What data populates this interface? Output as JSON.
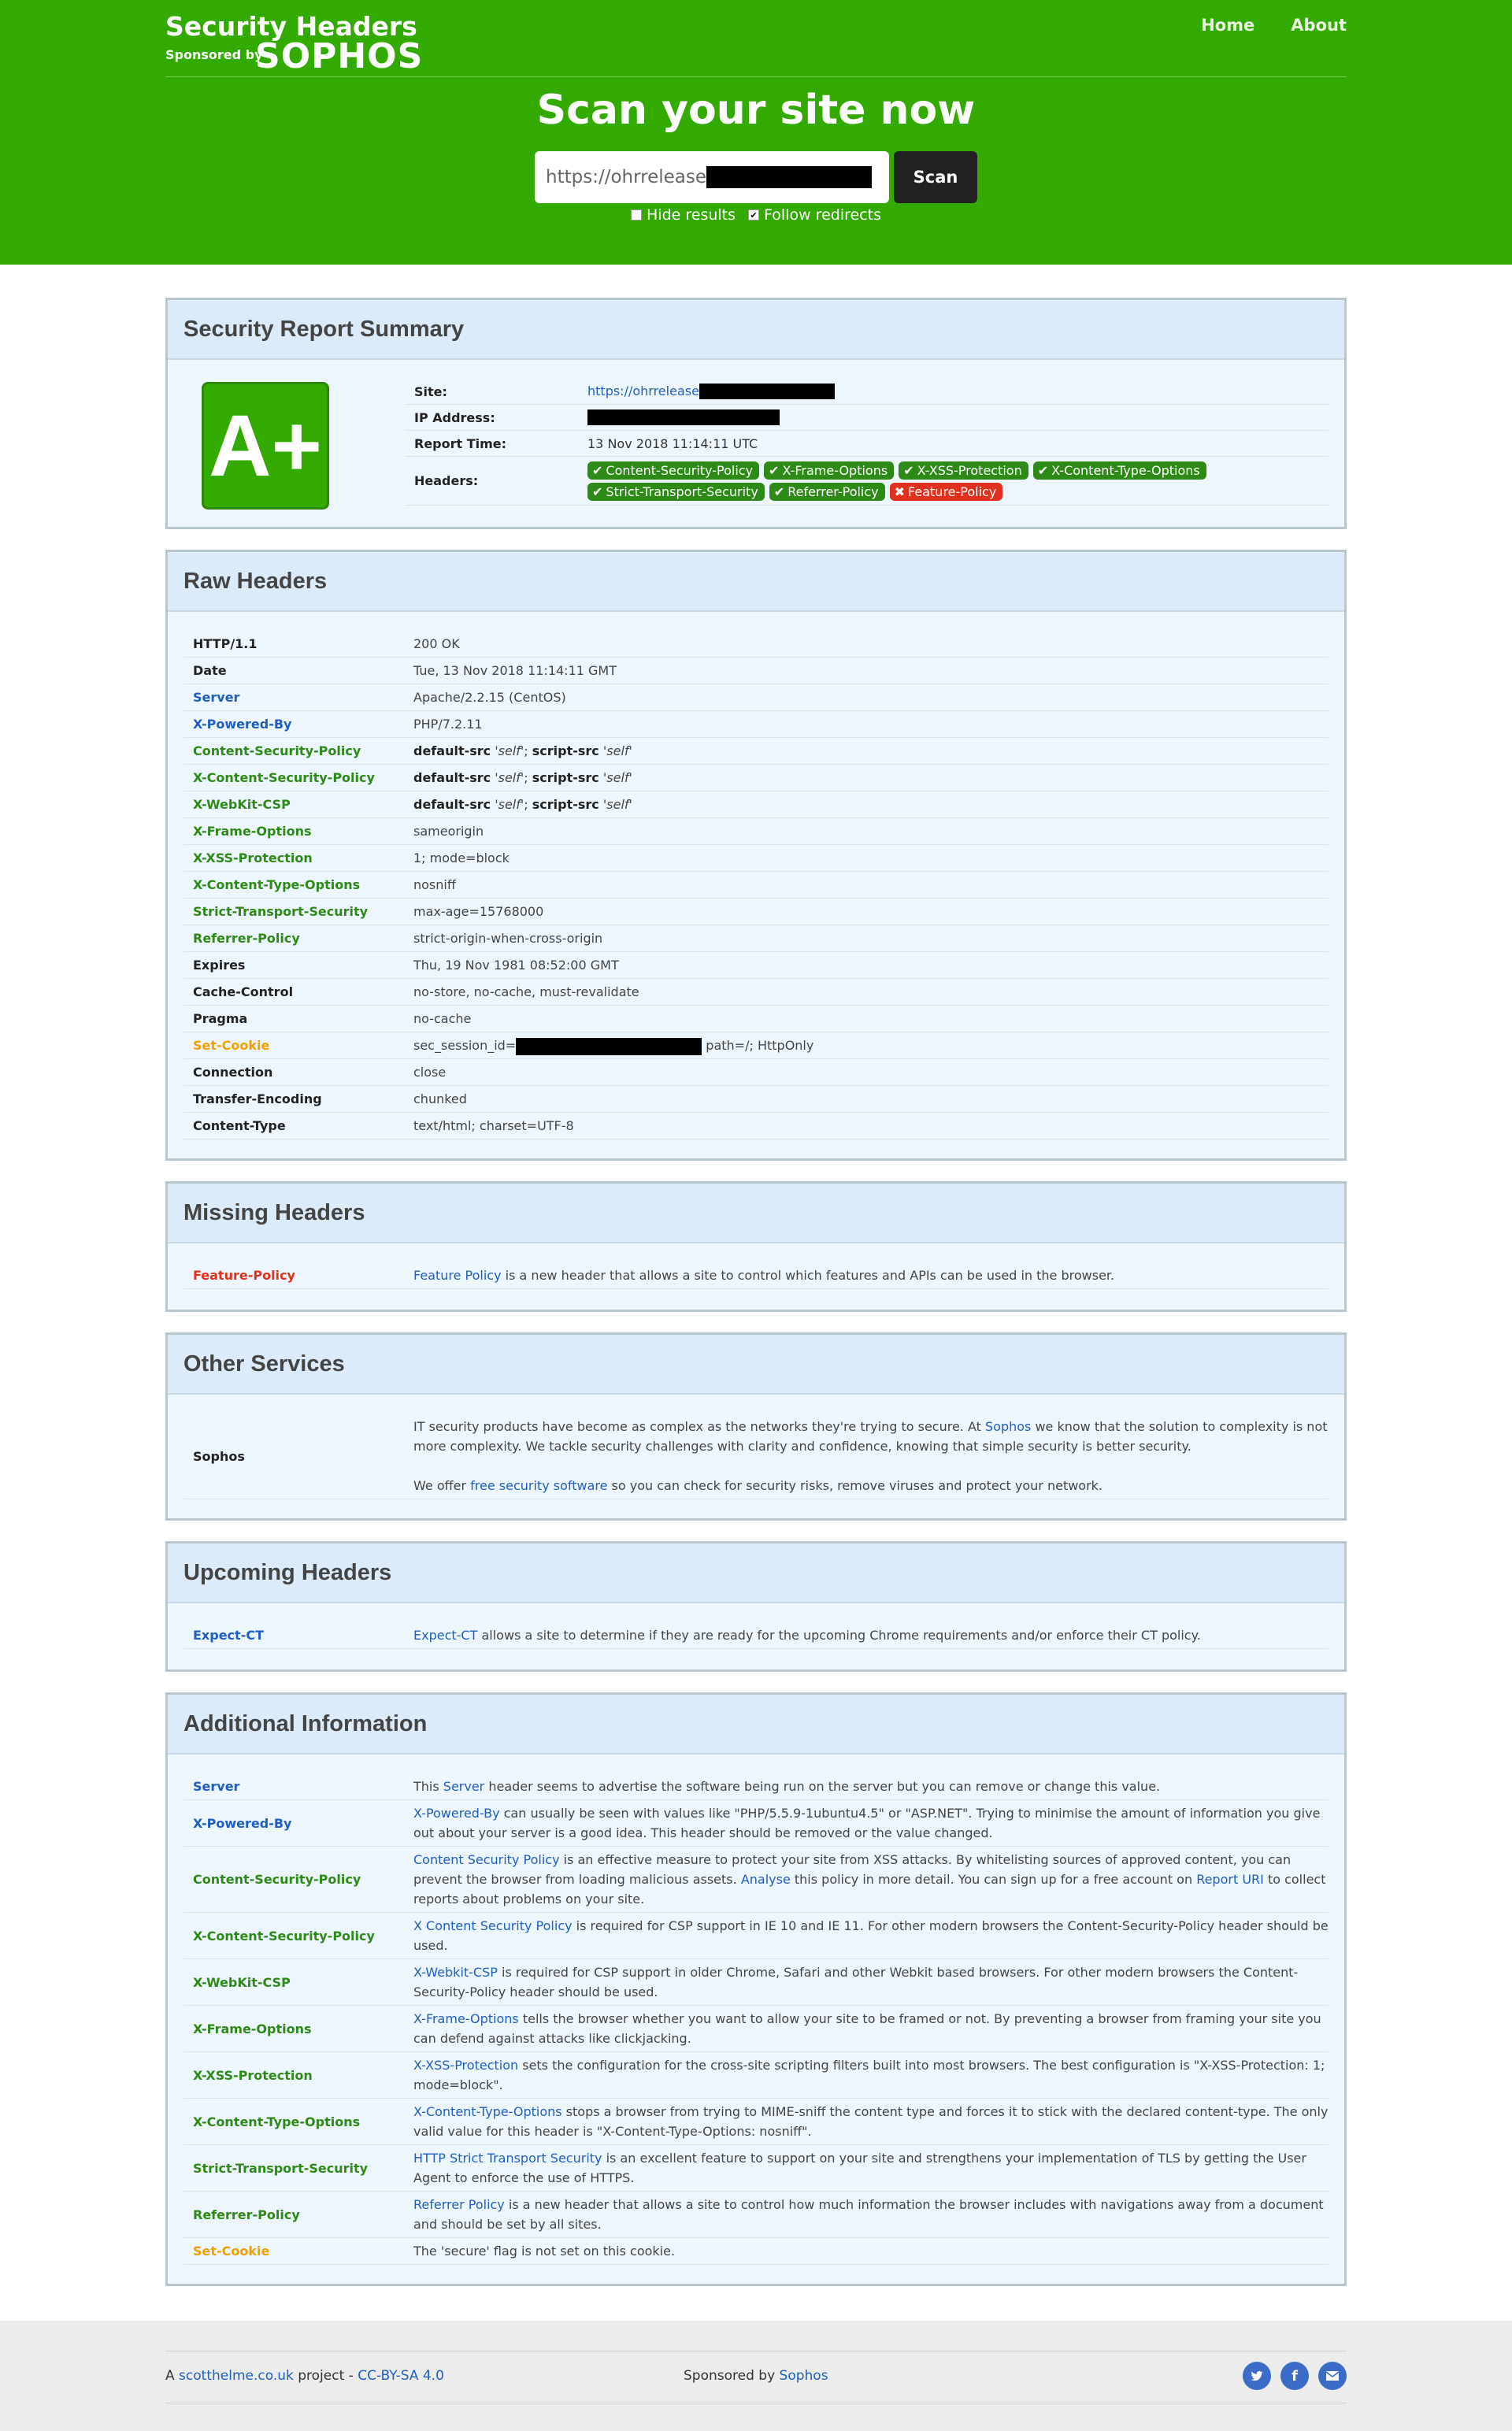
{
  "header": {
    "brand_title": "Security Headers",
    "sponsored_by": "Sponsored by",
    "sponsor_logo": "SOPHOS",
    "nav": {
      "home": "Home",
      "about": "About"
    },
    "headline": "Scan your site now",
    "url_value": "https://ohrrelease",
    "scan_label": "Scan",
    "hide_results_label": "Hide results",
    "follow_redirects_label": "Follow redirects"
  },
  "summary": {
    "title": "Security Report Summary",
    "grade": "A+",
    "rows": {
      "site_key": "Site:",
      "site_val": "https://ohrrelease",
      "ip_key": "IP Address:",
      "time_key": "Report Time:",
      "time_val": "13 Nov 2018 11:14:11 UTC",
      "headers_key": "Headers:"
    },
    "badges": [
      {
        "label": "Content-Security-Policy",
        "ok": true
      },
      {
        "label": "X-Frame-Options",
        "ok": true
      },
      {
        "label": "X-XSS-Protection",
        "ok": true
      },
      {
        "label": "X-Content-Type-Options",
        "ok": true
      },
      {
        "label": "Strict-Transport-Security",
        "ok": true
      },
      {
        "label": "Referrer-Policy",
        "ok": true
      },
      {
        "label": "Feature-Policy",
        "ok": false
      }
    ]
  },
  "raw": {
    "title": "Raw Headers",
    "rows": [
      {
        "key": "HTTP/1.1",
        "val": "200 OK",
        "color": "black"
      },
      {
        "key": "Date",
        "val": "Tue, 13 Nov 2018 11:14:11 GMT",
        "color": "black"
      },
      {
        "key": "Server",
        "val": "Apache/2.2.15 (CentOS)",
        "color": "blue"
      },
      {
        "key": "X-Powered-By",
        "val": "PHP/7.2.11",
        "color": "blue"
      },
      {
        "key": "Content-Security-Policy",
        "csp": true,
        "color": "green"
      },
      {
        "key": "X-Content-Security-Policy",
        "csp": true,
        "color": "green"
      },
      {
        "key": "X-WebKit-CSP",
        "csp": true,
        "color": "green"
      },
      {
        "key": "X-Frame-Options",
        "val": "sameorigin",
        "color": "green"
      },
      {
        "key": "X-XSS-Protection",
        "val": "1; mode=block",
        "color": "green"
      },
      {
        "key": "X-Content-Type-Options",
        "val": "nosniff",
        "color": "green"
      },
      {
        "key": "Strict-Transport-Security",
        "val": "max-age=15768000",
        "color": "green"
      },
      {
        "key": "Referrer-Policy",
        "val": "strict-origin-when-cross-origin",
        "color": "green"
      },
      {
        "key": "Expires",
        "val": "Thu, 19 Nov 1981 08:52:00 GMT",
        "color": "black"
      },
      {
        "key": "Cache-Control",
        "val": "no-store, no-cache, must-revalidate",
        "color": "black"
      },
      {
        "key": "Pragma",
        "val": "no-cache",
        "color": "black"
      },
      {
        "key": "Set-Cookie",
        "cookie": true,
        "val": "sec_session_id=",
        "val2": " path=/; HttpOnly",
        "color": "orange"
      },
      {
        "key": "Connection",
        "val": "close",
        "color": "black"
      },
      {
        "key": "Transfer-Encoding",
        "val": "chunked",
        "color": "black"
      },
      {
        "key": "Content-Type",
        "val": "text/html; charset=UTF-8",
        "color": "black"
      }
    ],
    "csp_parts": {
      "d": "default-src",
      "self1": " 'self'",
      "semi": "; ",
      "s": "script-src",
      "self2": " 'self'"
    }
  },
  "missing": {
    "title": "Missing Headers",
    "key": "Feature-Policy",
    "link": "Feature Policy",
    "text": " is a new header that allows a site to control which features and APIs can be used in the browser."
  },
  "other": {
    "title": "Other Services",
    "key": "Sophos",
    "p1a": "IT security products have become as complex as the networks they're trying to secure. At ",
    "p1link": "Sophos",
    "p1b": " we know that the solution to complexity is not more complexity. We tackle security challenges with clarity and confidence, knowing that simple security is better security.",
    "p2a": "We offer ",
    "p2link": "free security software",
    "p2b": " so you can check for security risks, remove viruses and protect your network."
  },
  "upcoming": {
    "title": "Upcoming Headers",
    "key": "Expect-CT",
    "link": "Expect-CT",
    "text": " allows a site to determine if they are ready for the upcoming Chrome requirements and/or enforce their CT policy."
  },
  "additional": {
    "title": "Additional Information",
    "rows": [
      {
        "key": "Server",
        "color": "blue",
        "pre": "This ",
        "link": "Server",
        "text": " header seems to advertise the software being run on the server but you can remove or change this value."
      },
      {
        "key": "X-Powered-By",
        "color": "blue",
        "pre": "",
        "link": "X-Powered-By",
        "text": " can usually be seen with values like \"PHP/5.5.9-1ubuntu4.5\" or \"ASP.NET\". Trying to minimise the amount of information you give out about your server is a good idea. This header should be removed or the value changed."
      },
      {
        "key": "Content-Security-Policy",
        "color": "green",
        "pre": "",
        "link": "Content Security Policy",
        "text": " is an effective measure to protect your site from XSS attacks. By whitelisting sources of approved content, you can prevent the browser from loading malicious assets. ",
        "link2": "Analyse",
        "text2": " this policy in more detail. You can sign up for a free account on ",
        "link3": "Report URI",
        "text3": " to collect reports about problems on your site."
      },
      {
        "key": "X-Content-Security-Policy",
        "color": "green",
        "pre": "",
        "link": "X Content Security Policy",
        "text": " is required for CSP support in IE 10 and IE 11. For other modern browsers the Content-Security-Policy header should be used."
      },
      {
        "key": "X-WebKit-CSP",
        "color": "green",
        "pre": "",
        "link": "X-Webkit-CSP",
        "text": " is required for CSP support in older Chrome, Safari and other Webkit based browsers. For other modern browsers the Content-Security-Policy header should be used."
      },
      {
        "key": "X-Frame-Options",
        "color": "green",
        "pre": "",
        "link": "X-Frame-Options",
        "text": " tells the browser whether you want to allow your site to be framed or not. By preventing a browser from framing your site you can defend against attacks like clickjacking."
      },
      {
        "key": "X-XSS-Protection",
        "color": "green",
        "pre": "",
        "link": "X-XSS-Protection",
        "text": " sets the configuration for the cross-site scripting filters built into most browsers. The best configuration is \"X-XSS-Protection: 1; mode=block\"."
      },
      {
        "key": "X-Content-Type-Options",
        "color": "green",
        "pre": "",
        "link": "X-Content-Type-Options",
        "text": " stops a browser from trying to MIME-sniff the content type and forces it to stick with the declared content-type. The only valid value for this header is \"X-Content-Type-Options: nosniff\"."
      },
      {
        "key": "Strict-Transport-Security",
        "color": "green",
        "pre": "",
        "link": "HTTP Strict Transport Security",
        "text": " is an excellent feature to support on your site and strengthens your implementation of TLS by getting the User Agent to enforce the use of HTTPS."
      },
      {
        "key": "Referrer-Policy",
        "color": "green",
        "pre": "",
        "link": "Referrer Policy",
        "text": " is a new header that allows a site to control how much information the browser includes with navigations away from a document and should be set by all sites."
      },
      {
        "key": "Set-Cookie",
        "color": "orange",
        "pre": "The 'secure' flag is not set on this cookie.",
        "link": "",
        "text": ""
      }
    ]
  },
  "footer": {
    "a": "A ",
    "site_link": "scotthelme.co.uk",
    "project": " project - ",
    "license": "CC-BY-SA 4.0",
    "sponsored": "Sponsored by ",
    "sponsor_link": "Sophos",
    "icons": [
      "twitter-icon",
      "facebook-icon",
      "email-icon"
    ]
  },
  "colors": {
    "brand_green": "#33aa00",
    "ok_badge": "#2e8a17",
    "bad_badge": "#e0301e",
    "link_blue": "#1f5fc0",
    "orange": "#f0a000"
  }
}
